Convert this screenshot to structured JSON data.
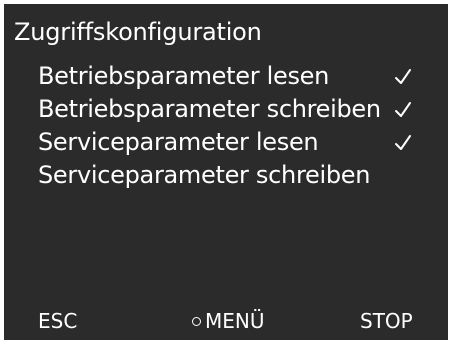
{
  "screen": {
    "title": "Zugriffskonfiguration"
  },
  "permissions": [
    {
      "label": "Betriebsparameter lesen",
      "checked": true,
      "icon": "check-icon"
    },
    {
      "label": "Betriebsparameter schreiben",
      "checked": true,
      "icon": "check-icon"
    },
    {
      "label": "Serviceparameter lesen",
      "checked": true,
      "icon": "check-icon"
    },
    {
      "label": "Serviceparameter schreiben",
      "checked": false,
      "icon": "check-icon"
    }
  ],
  "softkeys": {
    "left": "ESC",
    "center": "MENÜ",
    "center_icon": "circle-icon",
    "right": "STOP"
  },
  "colors": {
    "background": "#2b2b2b",
    "text": "#ffffff"
  }
}
